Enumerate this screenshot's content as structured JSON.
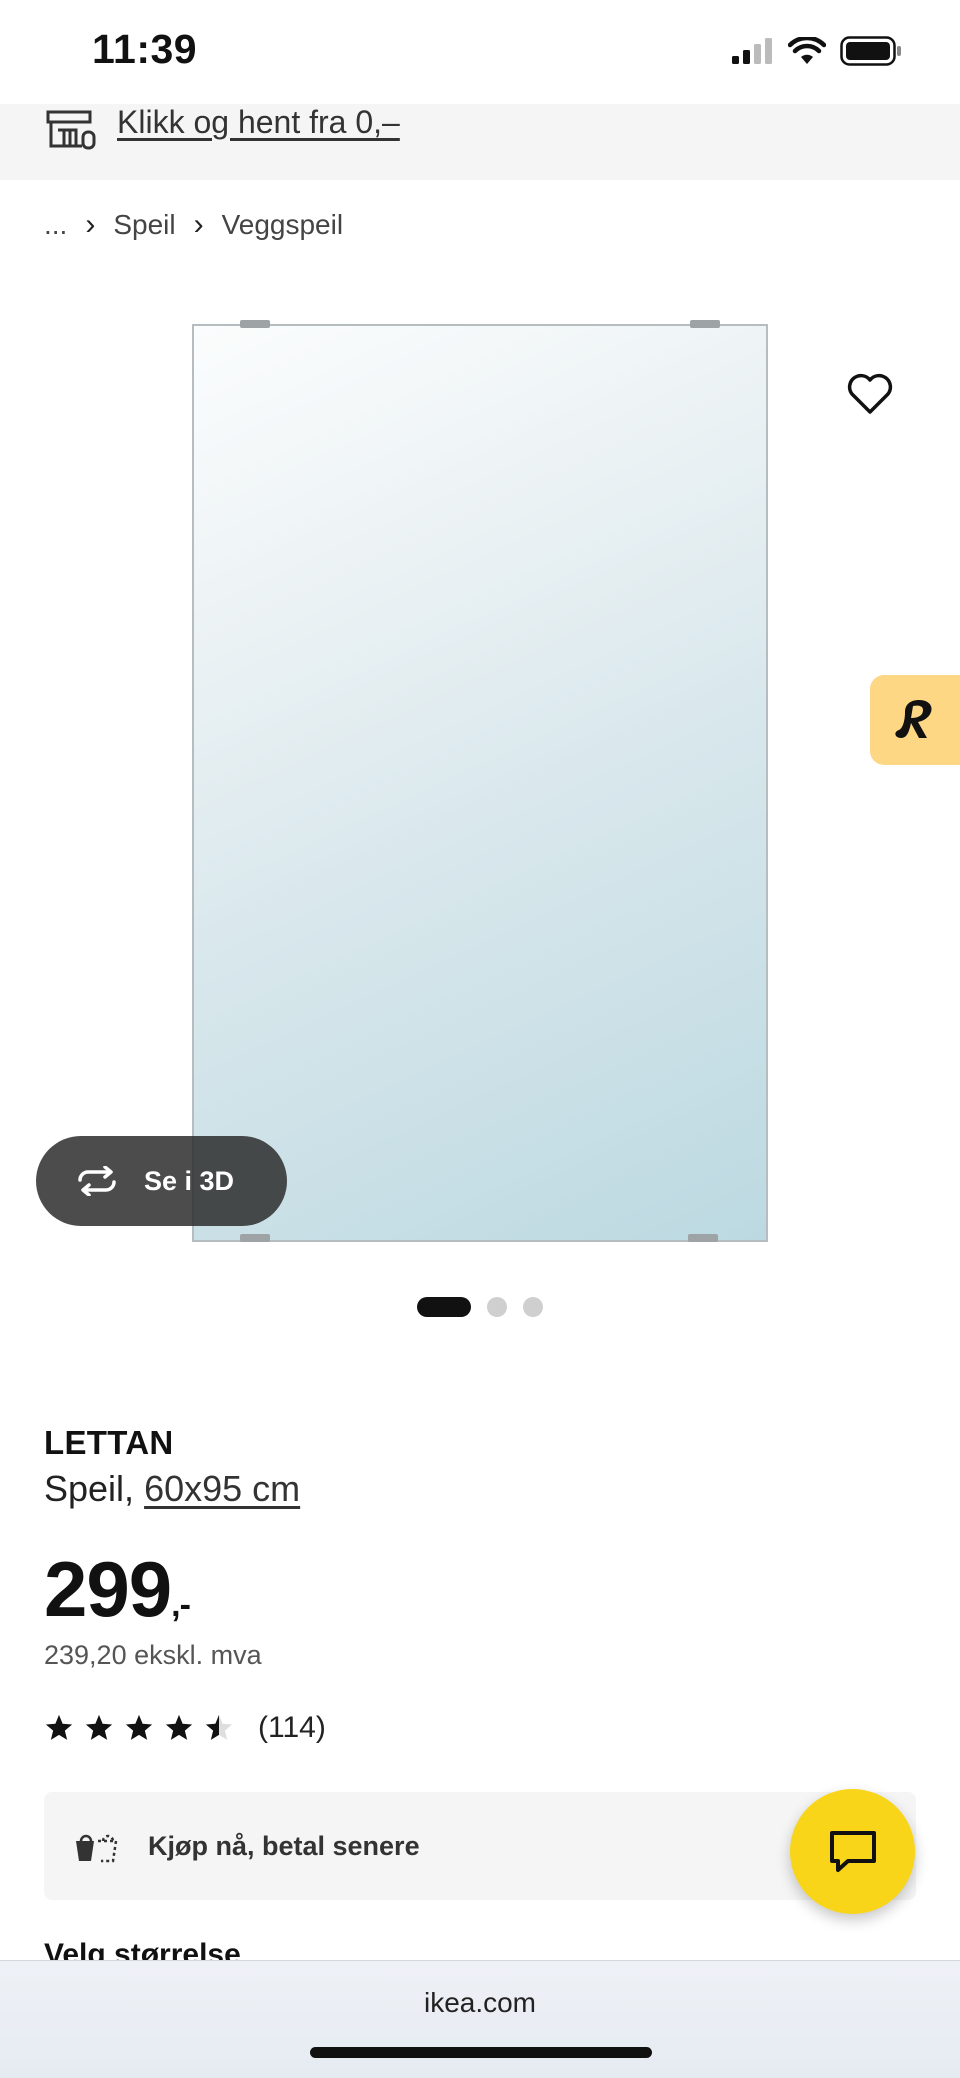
{
  "status_bar": {
    "time": "11:39"
  },
  "promo": {
    "link_text": "Klikk og hent fra 0,–"
  },
  "breadcrumb": {
    "items": [
      "...",
      "Speil",
      "Veggspeil"
    ]
  },
  "gallery": {
    "view_3d_label": "Se i 3D",
    "image_count": 3,
    "active_index": 0
  },
  "product": {
    "name": "LETTAN",
    "type": "Speil,",
    "size": "60x95 cm",
    "price_main": "299",
    "price_suffix": ",-",
    "price_ex_vat": "239,20 ekskl. mva",
    "rating_value": 4.5,
    "rating_max": 5,
    "review_count": "(114)"
  },
  "payment": {
    "label": "Kjøp nå, betal senere"
  },
  "next_section": {
    "heading": "Velg størrelse"
  },
  "browser": {
    "url": "ikea.com"
  },
  "colors": {
    "chat_fab": "#f8d519",
    "badge_bg": "#fdd783",
    "text": "#111111"
  }
}
